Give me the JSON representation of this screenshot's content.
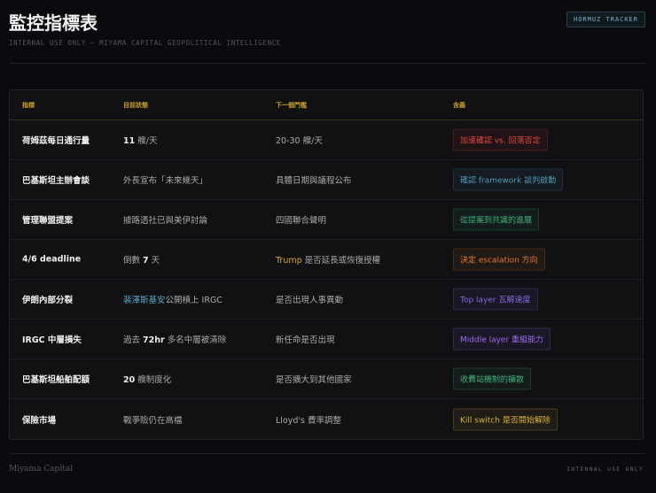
{
  "header": {
    "title": "監控指標表",
    "badge": "HORMUZ TRACKER",
    "subtitle": "INTERNAL USE ONLY — MIYAMA CAPITAL GEOPOLITICAL INTELLIGENCE"
  },
  "table": {
    "columns": [
      "指標",
      "目前狀態",
      "下一個門檻",
      "含義"
    ],
    "rows": [
      {
        "indicator": "荷姆茲每日通行量",
        "status_bold": "11",
        "status": " 艘/天",
        "next": "20-30 艘/天",
        "meaning": "加速確認 vs. 回落否定",
        "tag_color": "#e0463c"
      },
      {
        "indicator": "巴基斯坦主辦會談",
        "status": "外長宣布「未來幾天」",
        "next": "具體日期與議程公布",
        "meaning": "確認 framework 談判啟動",
        "tag_color": "#4f9ab5"
      },
      {
        "indicator": "管理聯盟提案",
        "status": "據路透社已與美伊討論",
        "next": "四國聯合聲明",
        "meaning": "從提案到共識的進展",
        "tag_color": "#3fae7a"
      },
      {
        "indicator": "4/6 deadline",
        "status_pre": "倒數 ",
        "status_bold": "7",
        "status": " 天",
        "next_hl": "Trump",
        "next": " 是否延長或恢復授權",
        "meaning": "決定 escalation 方向",
        "tag_color": "#e07a2e"
      },
      {
        "indicator": "伊朗內部分裂",
        "status_hl": "裴澤斯基安",
        "status": "公開槓上 IRGC",
        "next": "是否出現人事異動",
        "meaning": "Top layer 瓦解速度",
        "tag_color": "#8a6ae0"
      },
      {
        "indicator": "IRGC 中層損失",
        "status_pre": "過去 ",
        "status_bold": "72hr",
        "status": " 多名中層被清除",
        "next": "新任命是否出現",
        "meaning": "Middle layer 重組能力",
        "tag_color": "#9a6ef0"
      },
      {
        "indicator": "巴基斯坦船舶配額",
        "status_bold": "20",
        "status": " 艘制度化",
        "next": "是否擴大到其他國家",
        "meaning": "收費站機制的擴散",
        "tag_color": "#3fae7a"
      },
      {
        "indicator": "保險市場",
        "status": "戰爭險仍在高檔",
        "next": "Lloyd's 費率調整",
        "meaning": "Kill switch 是否開始解除",
        "tag_color": "#d6b43a"
      }
    ]
  },
  "footer": {
    "left": "Miyama Capital",
    "right": "INTERNAL USE ONLY"
  }
}
